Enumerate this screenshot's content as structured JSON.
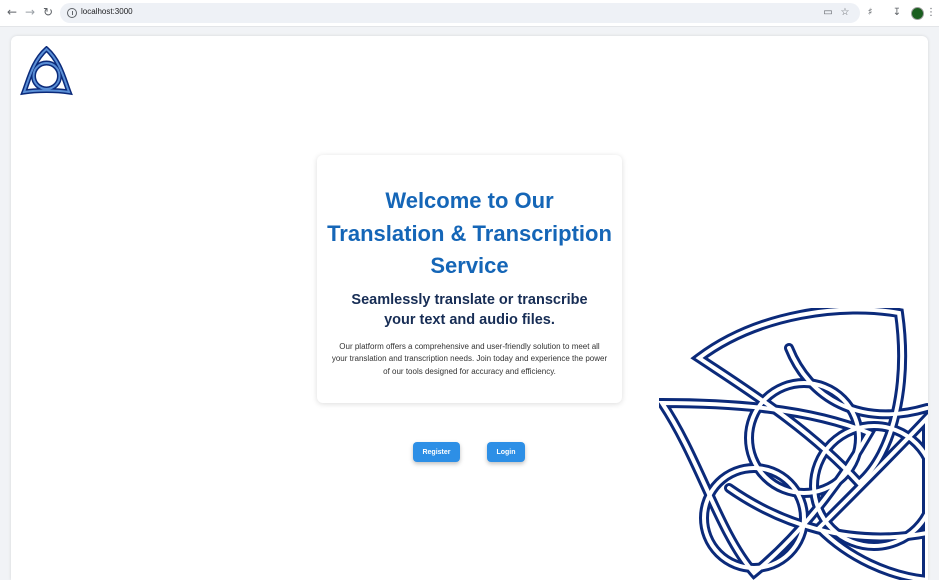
{
  "browser": {
    "url": "localhost:3000",
    "icons": [
      "back-icon",
      "forward-icon",
      "reload-icon",
      "info-icon",
      "cast-icon",
      "star-icon",
      "extensions-icon",
      "download-icon",
      "profile-avatar",
      "menu-icon"
    ]
  },
  "hero": {
    "title": "Welcome to Our Translation & Transcription Service",
    "subtitle": "Seamlessly translate or transcribe your text and audio files.",
    "description": "Our platform offers a comprehensive and user-friendly solution to meet all your translation and transcription needs. Join today and experience the power of our tools designed for accuracy and efficiency."
  },
  "actions": {
    "register_label": "Register",
    "login_label": "Login"
  },
  "colors": {
    "title": "#1566b7",
    "subtitle": "#172d55",
    "button": "#2d8fe6",
    "knot": "#0b2a7a"
  }
}
